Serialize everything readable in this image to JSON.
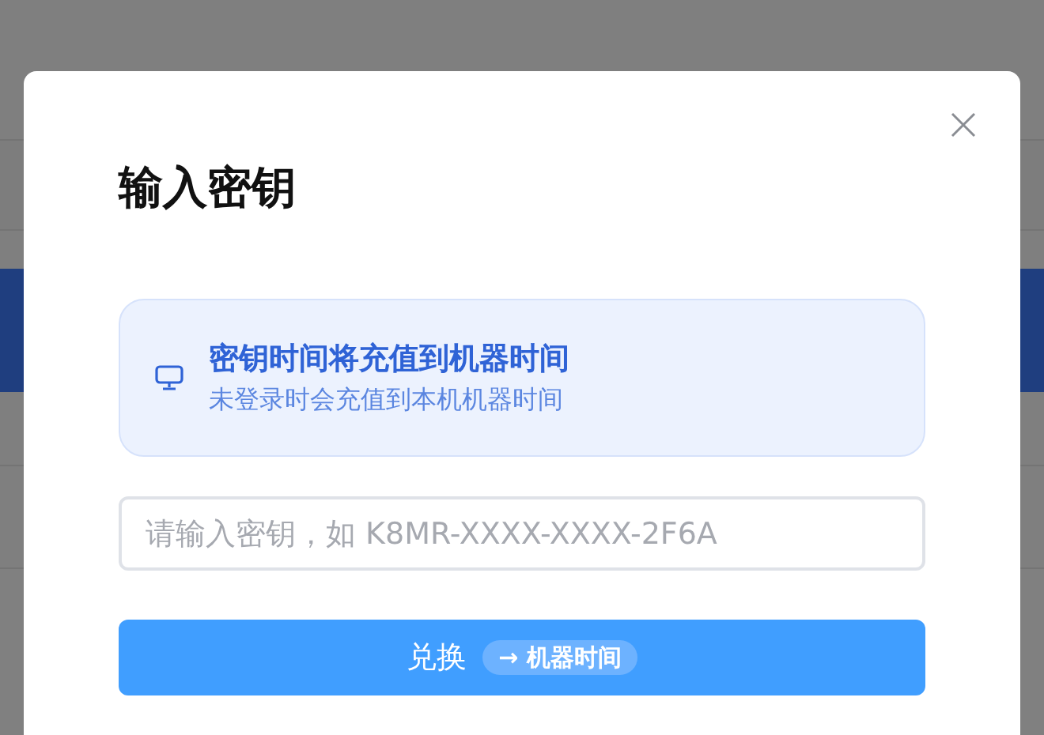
{
  "dialog": {
    "title": "输入密钥",
    "notice": {
      "title": "密钥时间将充值到机器时间",
      "text": "未登录时会充值到本机机器时间"
    },
    "key_field": {
      "placeholder": "请输入密钥，如 K8MR-XXXX-XXXX-2F6A"
    },
    "redeem_button": {
      "label": "兑换",
      "tag": "→ 机器时间"
    }
  }
}
